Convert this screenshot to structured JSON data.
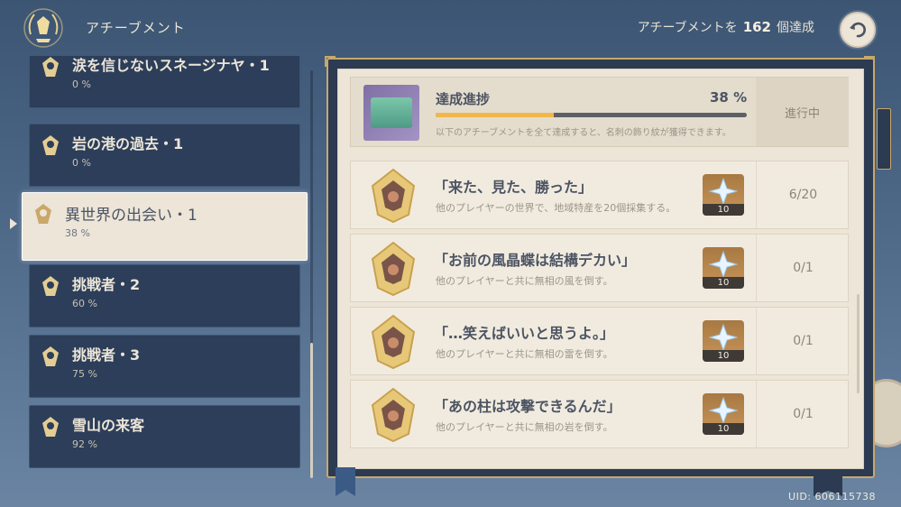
{
  "header": {
    "title": "アチーブメント",
    "summary_prefix": "アチーブメントを",
    "summary_count": "162",
    "summary_suffix": "個達成",
    "back_icon": "back-arrow-icon"
  },
  "categories": [
    {
      "name": "涙を信じないスネージナヤ・1",
      "percent": "0 %"
    },
    {
      "name": "岩の港の過去・1",
      "percent": "0 %"
    },
    {
      "name": "異世界の出会い・1",
      "percent": "38 %",
      "selected": true
    },
    {
      "name": "挑戦者・2",
      "percent": "60 %"
    },
    {
      "name": "挑戦者・3",
      "percent": "75 %"
    },
    {
      "name": "雪山の来客",
      "percent": "92 %"
    }
  ],
  "progress": {
    "title": "達成進捗",
    "percent": "38 %",
    "value": 0.38,
    "description": "以下のアチーブメントを全て達成すると、名刺の飾り紋が獲得できます。",
    "status": "進行中"
  },
  "achievements": [
    {
      "title": "「来た、見た、勝った」",
      "description": "他のプレイヤーの世界で、地域特産を20個採集する。",
      "reward_count": "10",
      "status": "6/20"
    },
    {
      "title": "「お前の風晶蝶は結構デカい」",
      "description": "他のプレイヤーと共に無相の風を倒す。",
      "reward_count": "10",
      "status": "0/1"
    },
    {
      "title": "「…笑えばいいと思うよ。」",
      "description": "他のプレイヤーと共に無相の雷を倒す。",
      "reward_count": "10",
      "status": "0/1"
    },
    {
      "title": "「あの柱は攻撃できるんだ」",
      "description": "他のプレイヤーと共に無相の岩を倒す。",
      "reward_count": "10",
      "status": "0/1"
    }
  ],
  "footer": {
    "uid": "UID: 606115738"
  },
  "colors": {
    "accent_gold": "#f2b74a",
    "panel_bg": "#ece5d8",
    "category_bg": "#2c3e59"
  }
}
